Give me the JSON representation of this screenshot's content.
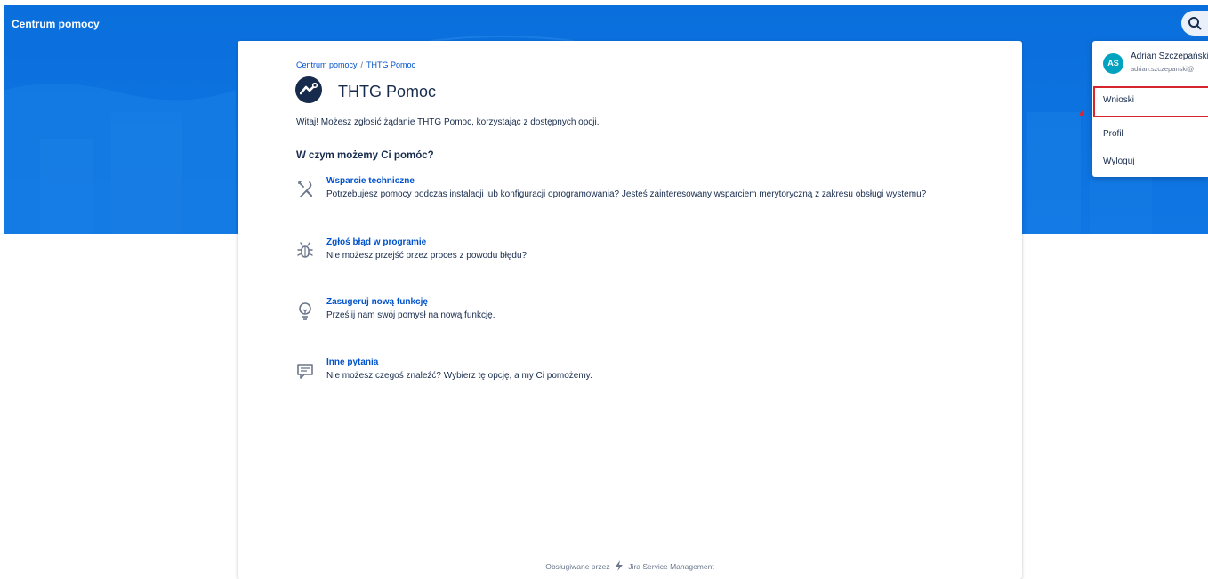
{
  "header": {
    "title": "Centrum pomocy"
  },
  "breadcrumb": {
    "root": "Centrum pomocy",
    "separator": "/",
    "current": "THTG Pomoc"
  },
  "project": {
    "title": "THTG Pomoc"
  },
  "welcome_text": "Witaj! Możesz zgłosić żądanie THTG Pomoc, korzystając z dostępnych opcji.",
  "section_heading": "W czym możemy Ci pomóc?",
  "options": [
    {
      "title": "Wsparcie techniczne",
      "description": "Potrzebujesz pomocy podczas instalacji lub konfiguracji oprogramowania? Jesteś zainteresowany wsparciem merytoryczną z zakresu obsługi wystemu?",
      "icon": "tools-icon"
    },
    {
      "title": "Zgłoś błąd w programie",
      "description": "Nie możesz przejść przez proces z powodu błędu?",
      "icon": "bug-icon"
    },
    {
      "title": "Zasugeruj nową funkcję",
      "description": "Prześlij nam swój pomysł na nową funkcję.",
      "icon": "lightbulb-icon"
    },
    {
      "title": "Inne pytania",
      "description": "Nie możesz czegoś znaleźć? Wybierz tę opcję, a my Ci pomożemy.",
      "icon": "comment-icon"
    }
  ],
  "footer": {
    "prefix": "Obsługiwane przez",
    "product": "Jira Service Management"
  },
  "user_menu": {
    "initials": "AS",
    "name": "Adrian Szczepański",
    "email": "adrian.szczepanski@",
    "items": [
      "Wnioski",
      "Profil",
      "Wyloguj"
    ]
  },
  "colors": {
    "banner": "#0f76e3",
    "link": "#0052cc",
    "avatar": "#00a3bf",
    "highlight": "#d6252d"
  }
}
